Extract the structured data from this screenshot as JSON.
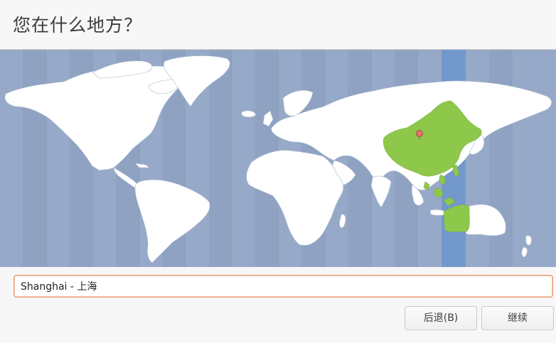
{
  "header": {
    "title": "您在什么地方？"
  },
  "map": {
    "selected_region": "Asia/Shanghai",
    "colors": {
      "ocean": "#97a9c8",
      "land": "#ffffff",
      "selected_zone": "#7398cc",
      "selected_country": "#8dc84b",
      "pin": "#e8726a"
    }
  },
  "timezone": {
    "value": "Shanghai - 上海"
  },
  "buttons": {
    "back_label": "后退(B)",
    "continue_label": "继续"
  }
}
